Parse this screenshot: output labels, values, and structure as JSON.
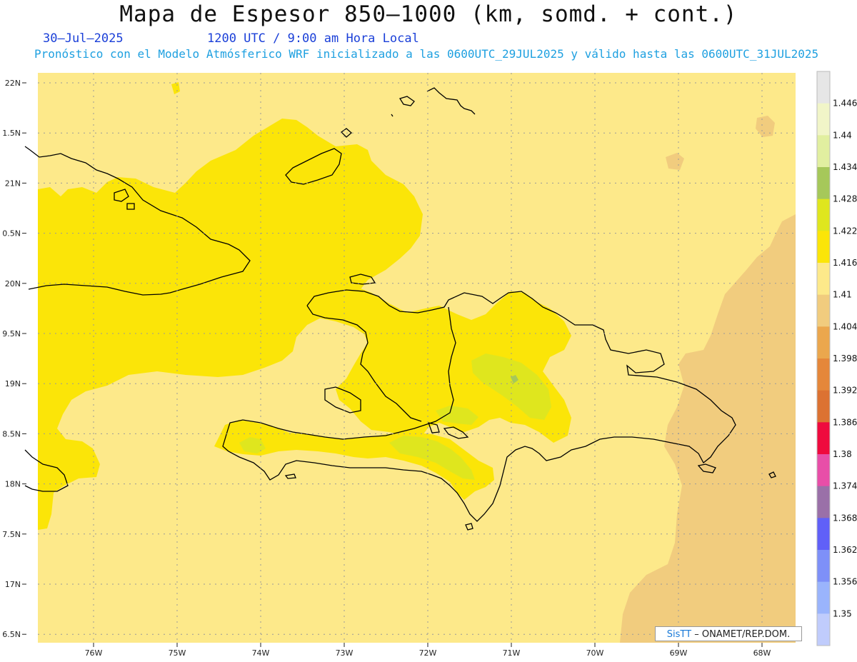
{
  "header": {
    "title": "Mapa de Espesor 850–1000 (km, somd. + cont.)",
    "date": "30–Jul–2025",
    "time": "1200 UTC / 9:00 am Hora Local",
    "subtitle": "Pronóstico con el Modelo Atmósferico WRF inicializado a las 0600UTC_29JUL2025 y válido hasta las  0600UTC_31JUL2025"
  },
  "map": {
    "lat_labels": [
      "22N",
      "1.5N",
      "21N",
      "0.5N",
      "20N",
      "9.5N",
      "19N",
      "8.5N",
      "18N",
      "7.5N",
      "17N",
      "6.5N"
    ],
    "lon_labels": [
      "76W",
      "75W",
      "74W",
      "73W",
      "72W",
      "71W",
      "70W",
      "69W",
      "68W"
    ],
    "colors": {
      "c1404": "#f1cc7e",
      "c1410": "#fde98a",
      "c1416": "#fbe508",
      "c1422": "#dfe61e",
      "coast": "#000000"
    }
  },
  "colorbar": {
    "labels": [
      "1.446",
      "1.44",
      "1.434",
      "1.428",
      "1.422",
      "1.416",
      "1.41",
      "1.404",
      "1.398",
      "1.392",
      "1.386",
      "1.38",
      "1.374",
      "1.368",
      "1.362",
      "1.356",
      "1.35"
    ],
    "colors": [
      "#e6e6e6",
      "#f1f5c8",
      "#e1efa0",
      "#a6c85a",
      "#dfe61e",
      "#fbe508",
      "#fde98a",
      "#f1cc7e",
      "#eba74d",
      "#e5873a",
      "#dc7232",
      "#ef0a3e",
      "#e84ea8",
      "#9a70a8",
      "#6060f8",
      "#7e90f8",
      "#9ab4fc",
      "#c0ccfc"
    ]
  },
  "credit": {
    "brand": "SisTT",
    "text": "–  ONAMET/REP.DOM."
  }
}
